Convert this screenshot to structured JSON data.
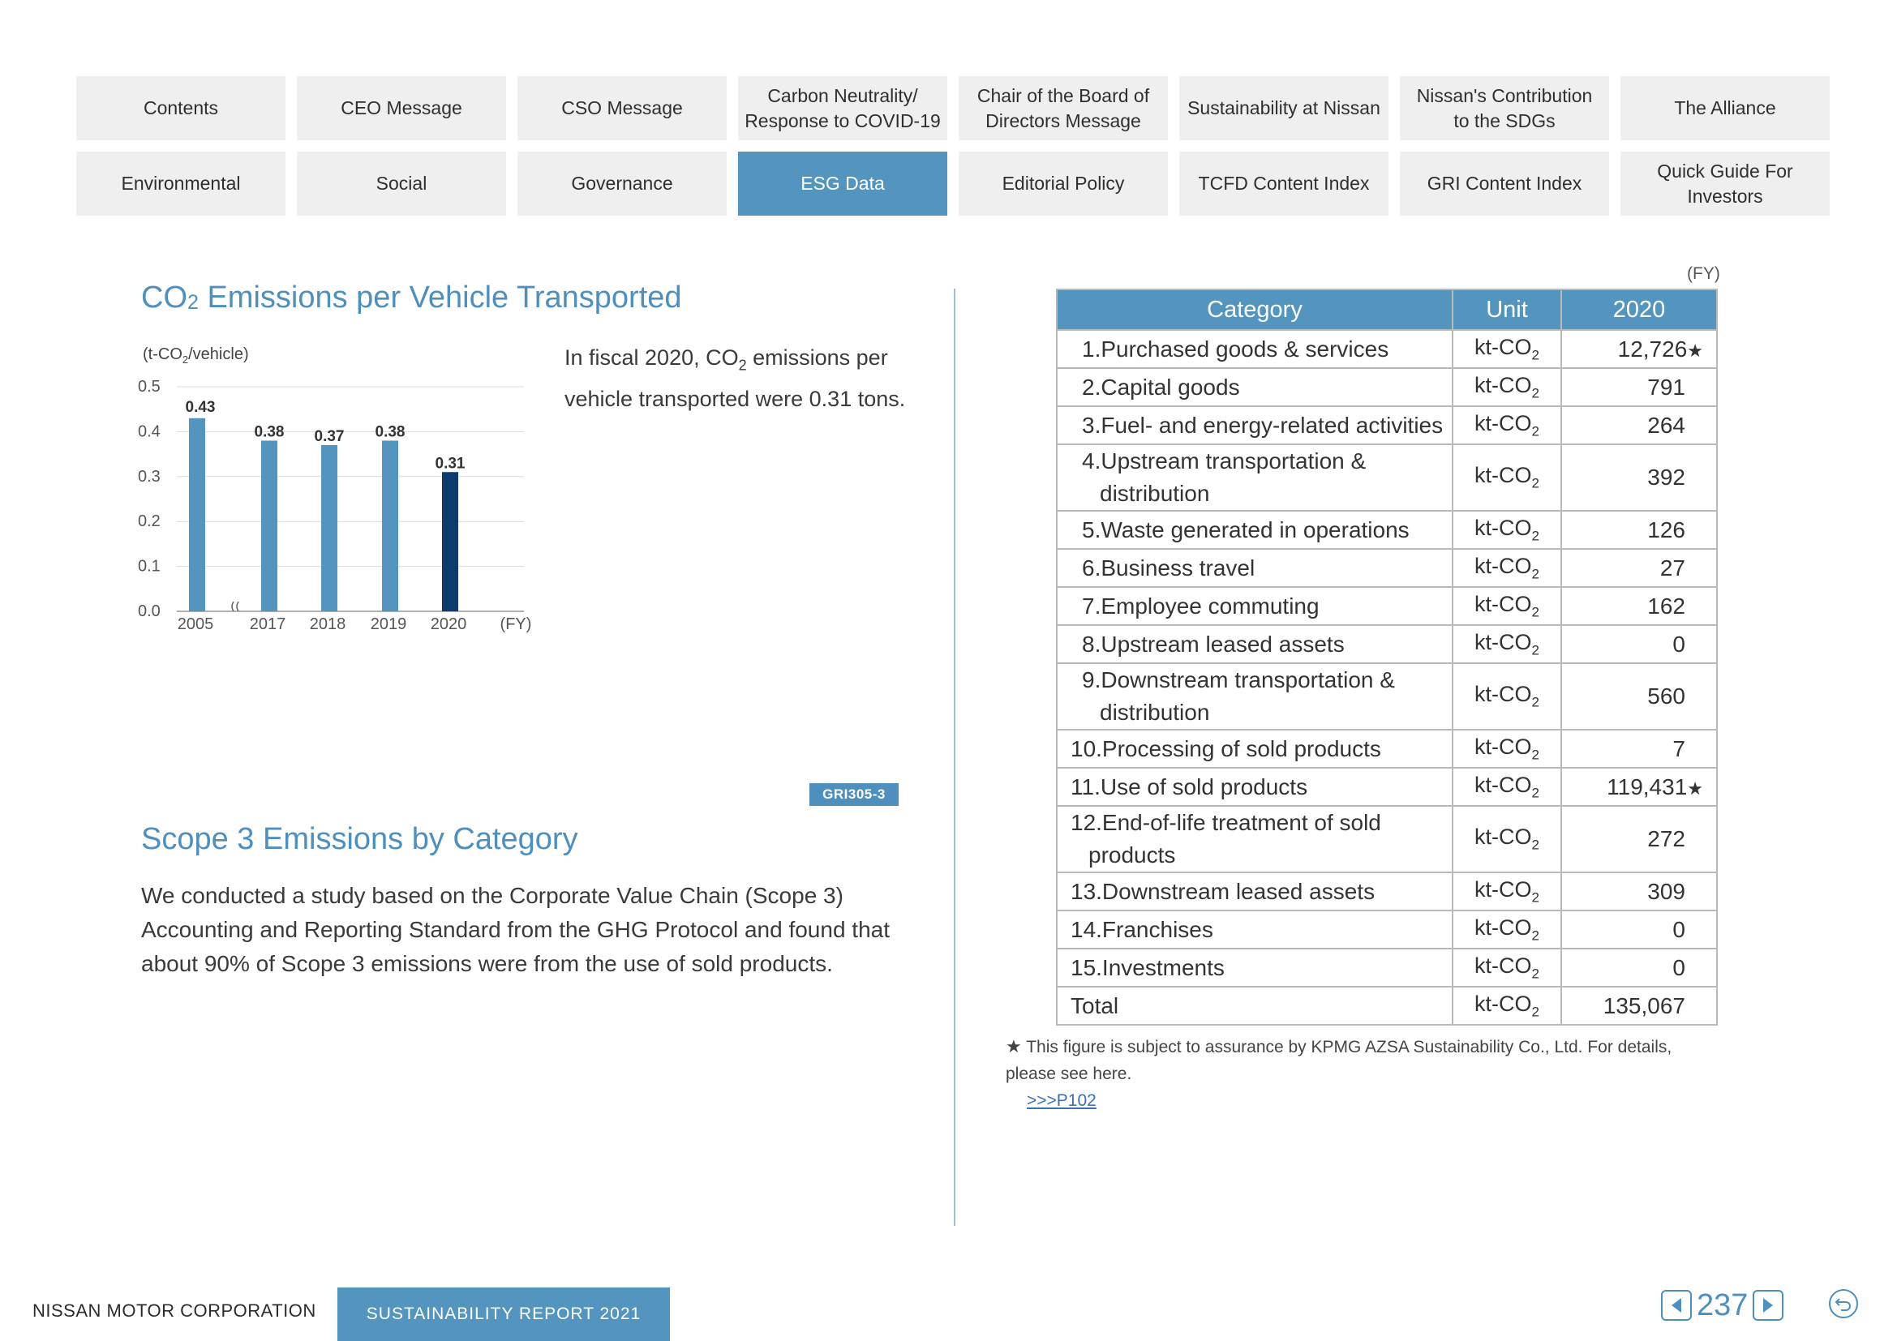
{
  "nav": {
    "tabs": [
      {
        "label": "Contents"
      },
      {
        "label": "CEO Message"
      },
      {
        "label": "CSO Message"
      },
      {
        "label": "Carbon Neutrality/\nResponse to COVID-19"
      },
      {
        "label": "Chair of the Board of\nDirectors Message"
      },
      {
        "label": "Sustainability at Nissan"
      },
      {
        "label": "Nissan's Contribution\nto the SDGs"
      },
      {
        "label": "The Alliance"
      },
      {
        "label": "Environmental"
      },
      {
        "label": "Social"
      },
      {
        "label": "Governance"
      },
      {
        "label": "ESG Data",
        "active": true
      },
      {
        "label": "Editorial Policy"
      },
      {
        "label": "TCFD Content Index"
      },
      {
        "label": "GRI Content Index"
      },
      {
        "label": "Quick Guide For\nInvestors"
      }
    ]
  },
  "co2_section": {
    "title_prefix": "CO",
    "title_sub": "2",
    "title_rest": " Emissions per Vehicle Transported",
    "unit_prefix": "(t-CO",
    "unit_sub": "2",
    "unit_rest": "/vehicle)",
    "intro_1": "In fiscal 2020, CO",
    "intro_sub": "2",
    "intro_2": " emissions per vehicle transported were 0.31 tons."
  },
  "chart_data": {
    "type": "bar",
    "categories": [
      "2005",
      "2017",
      "2018",
      "2019",
      "2020"
    ],
    "values": [
      0.43,
      0.38,
      0.37,
      0.38,
      0.31
    ],
    "value_labels": [
      "0.43",
      "0.38",
      "0.37",
      "0.38",
      "0.31"
    ],
    "highlight_index": 4,
    "ylim": [
      0,
      0.5
    ],
    "yticks": [
      "0.0",
      "0.1",
      "0.2",
      "0.3",
      "0.4",
      "0.5"
    ],
    "ylabel": "(t-CO2/vehicle)",
    "xlabel": "(FY)",
    "axis_break_after": "2005",
    "grid": true,
    "colors": {
      "bar": "#5495bf",
      "highlight": "#0d3b6e",
      "grid": "#d9d9d9"
    }
  },
  "scope3": {
    "badge": "GRI305-3",
    "title": "Scope 3 Emissions by Category",
    "text": "We conducted a study based on the Corporate Value Chain (Scope 3) Accounting and Reporting Standard from the GHG Protocol and found that about 90% of Scope 3 emissions were from the use of sold products."
  },
  "table": {
    "fy_label": "(FY)",
    "headers": {
      "category": "Category",
      "unit": "Unit",
      "year": "2020"
    },
    "unit_prefix": "kt-CO",
    "unit_sub": "2",
    "rows": [
      {
        "line1": "1.Purchased goods & services",
        "line2": "",
        "value": "12,726",
        "star": "★"
      },
      {
        "line1": "2.Capital goods",
        "line2": "",
        "value": "791",
        "star": ""
      },
      {
        "line1": "3.Fuel- and energy-related activities",
        "line2": "",
        "value": "264",
        "star": ""
      },
      {
        "line1": "4.Upstream transportation &",
        "line2": "distribution",
        "value": "392",
        "star": ""
      },
      {
        "line1": "5.Waste generated in operations",
        "line2": "",
        "value": "126",
        "star": ""
      },
      {
        "line1": "6.Business travel",
        "line2": "",
        "value": "27",
        "star": ""
      },
      {
        "line1": "7.Employee commuting",
        "line2": "",
        "value": "162",
        "star": ""
      },
      {
        "line1": "8.Upstream leased assets",
        "line2": "",
        "value": "0",
        "star": ""
      },
      {
        "line1": "9.Downstream transportation &",
        "line2": "distribution",
        "value": "560",
        "star": ""
      },
      {
        "line1": "10.Processing of sold products",
        "line2": "",
        "value": "7",
        "star": ""
      },
      {
        "line1": "11.Use of sold products",
        "line2": "",
        "value": "119,431",
        "star": "★"
      },
      {
        "line1": "12.End-of-life treatment of sold",
        "line2": "products",
        "value": "272",
        "star": ""
      },
      {
        "line1": "13.Downstream leased assets",
        "line2": "",
        "value": "309",
        "star": ""
      },
      {
        "line1": "14.Franchises",
        "line2": "",
        "value": "0",
        "star": ""
      },
      {
        "line1": "15.Investments",
        "line2": "",
        "value": "0",
        "star": ""
      },
      {
        "line1": "Total",
        "line2": "",
        "value": "135,067",
        "star": ""
      }
    ]
  },
  "footnote": {
    "star": "★",
    "text": " This figure is subject to assurance by KPMG AZSA Sustainability Co., Ltd. For details, please see here.",
    "link": ">>>P102"
  },
  "footer": {
    "corp": "NISSAN MOTOR CORPORATION",
    "report": "SUSTAINABILITY REPORT 2021",
    "page": "237"
  },
  "icons": {
    "prev": "triangle-left-icon",
    "next": "triangle-right-icon",
    "back": "return-arrow-icon"
  }
}
